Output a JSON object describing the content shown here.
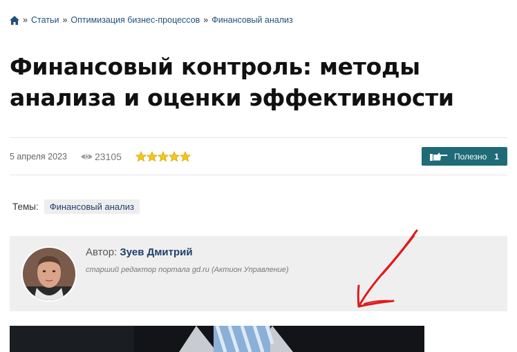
{
  "breadcrumb": {
    "items": [
      "Статьи",
      "Оптимизация бизнес-процессов",
      "Финансовый анализ"
    ],
    "separator": "»"
  },
  "article": {
    "title": "Финансовый контроль: методы анализа и оценки эффективности",
    "date": "5 апреля 2023",
    "views": "23105",
    "rating_stars": 5,
    "useful_label": "Полезно",
    "useful_count": "1"
  },
  "topics": {
    "label": "Темы:",
    "tags": [
      "Финансовый анализ"
    ]
  },
  "author": {
    "prefix": "Автор:",
    "name": "Зуев Дмитрий",
    "description": "старший редактор портала gd.ru (Актион Управление)"
  },
  "colors": {
    "link": "#1f4f7a",
    "button_bg": "#1f6b77",
    "star": "#f5c518",
    "arrow": "#e01a1a",
    "author_bg": "#efefef"
  },
  "icons": [
    "home-icon",
    "eye-icon",
    "star-icon",
    "pointing-hand-icon"
  ]
}
